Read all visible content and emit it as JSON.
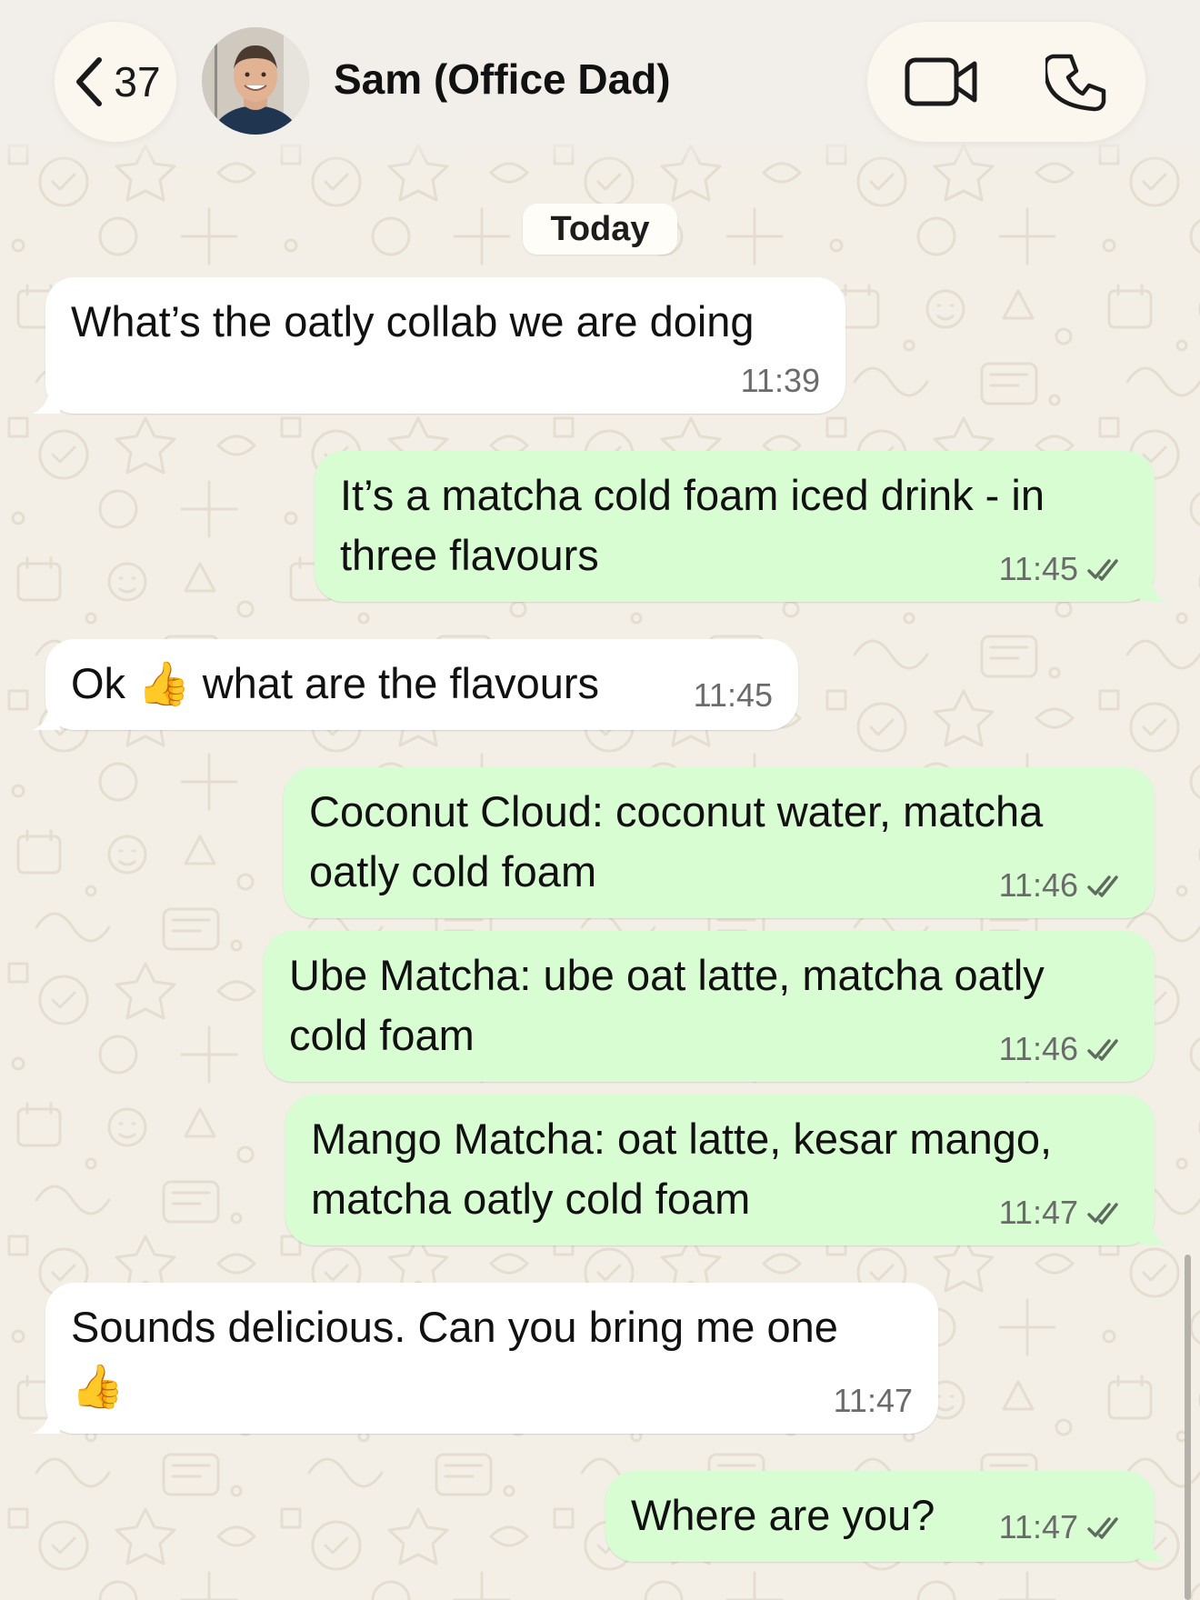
{
  "header": {
    "back_count": "37",
    "contact_name": "Sam (Office Dad)"
  },
  "date_chip": "Today",
  "messages": [
    {
      "dir": "in",
      "text": "What’s the oatly collab we are doing",
      "time": "11:39"
    },
    {
      "dir": "out",
      "line1": "It’s a matcha cold foam iced drink - in",
      "line2": "three flavours",
      "time": "11:45",
      "status": "read"
    },
    {
      "dir": "in",
      "text_before": "Ok",
      "emoji": "👍",
      "text_after": "what are the flavours",
      "time": "11:45"
    },
    {
      "dir": "out",
      "line1": "Coconut Cloud: coconut water, matcha",
      "line2": "oatly cold foam",
      "time": "11:46",
      "status": "read"
    },
    {
      "dir": "out",
      "line1": "Ube Matcha: ube oat latte, matcha oatly",
      "line2": "cold foam",
      "time": "11:46",
      "status": "read"
    },
    {
      "dir": "out",
      "line1": "Mango Matcha: oat latte, kesar mango,",
      "line2": "matcha oatly cold foam",
      "time": "11:47",
      "status": "read"
    },
    {
      "dir": "in",
      "line1": "Sounds delicious. Can you bring me one",
      "emoji": "👍",
      "time": "11:47"
    },
    {
      "dir": "out",
      "text": "Where are you?",
      "time": "11:47",
      "status": "read"
    }
  ],
  "icons": {
    "back": "chevron-left-icon",
    "video": "video-camera-icon",
    "phone": "phone-icon",
    "read_status": "double-check-icon"
  },
  "colors": {
    "background": "#f3efe7",
    "incoming_bubble": "#ffffff",
    "outgoing_bubble": "#d9fdd3",
    "tick": "#5f6b5e",
    "timestamp": "#6b6b6b"
  }
}
